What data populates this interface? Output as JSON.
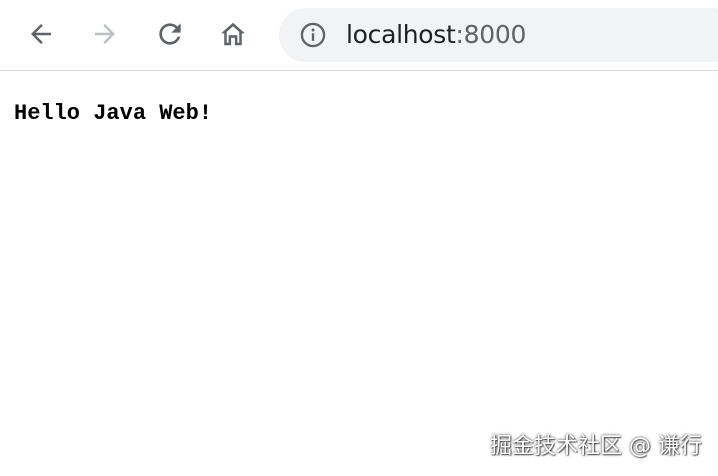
{
  "browser": {
    "address_bar": {
      "host": "localhost",
      "port_suffix": ":8000"
    },
    "icons": {
      "back": "arrow-left-icon",
      "forward": "arrow-right-icon",
      "reload": "reload-icon",
      "home": "home-icon",
      "site_info": "info-icon"
    },
    "colors": {
      "icon_active": "#5f6368",
      "icon_disabled": "#bdc1c6",
      "omnibox_bg": "#f1f3f4"
    }
  },
  "page": {
    "body_text": "Hello Java Web!"
  },
  "watermark": {
    "text": "掘金技术社区 @ 谦行"
  }
}
